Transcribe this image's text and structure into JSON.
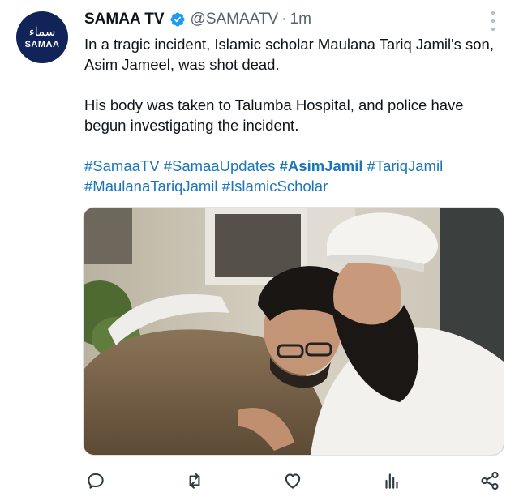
{
  "account": {
    "avatar_urdu": "سماء",
    "avatar_label": "SAMAA",
    "name": "SAMAA TV",
    "handle": "@SAMAATV",
    "separator": "·",
    "time": "1m"
  },
  "tweet": {
    "paragraph1": "In a tragic incident, Islamic scholar Maulana Tariq Jamil's son, Asim Jameel, was shot dead.",
    "paragraph2": "His body was taken to Talumba Hospital, and police have begun investigating the incident.",
    "hashtags": [
      "#SamaaTV",
      "#SamaaUpdates",
      "#AsimJamil",
      "#TariqJamil",
      "#MaulanaTariqJamil",
      "#IslamicScholar"
    ]
  },
  "colors": {
    "brand_navy": "#10245a",
    "link": "#1b75bb",
    "verified": "#1d9bf0",
    "muted": "#536471"
  },
  "icons": {
    "verified": "verified-badge-icon",
    "more": "more-options-icon",
    "reply": "reply-icon",
    "retweet": "retweet-icon",
    "like": "like-icon",
    "views": "views-icon",
    "share": "share-icon"
  }
}
